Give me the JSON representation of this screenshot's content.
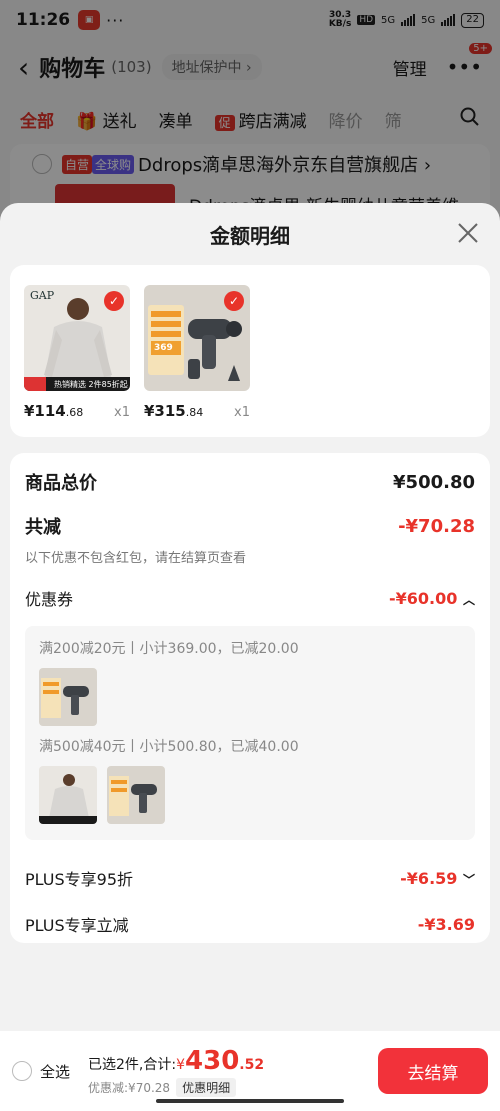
{
  "status": {
    "time": "11:26",
    "speed_top": "30.3",
    "speed_unit": "KB/s",
    "hd": "HD",
    "net1": "5G",
    "net2": "5G",
    "battery": "22"
  },
  "nav": {
    "title": "购物车",
    "count": "(103)",
    "address": "地址保护中 ›",
    "manage": "管理",
    "badge": "5+"
  },
  "filters": [
    "全部",
    "送礼",
    "凑单",
    "跨店满减",
    "降价",
    "筛"
  ],
  "promo_tag": "促",
  "store": {
    "tag_self": "自营",
    "tag_global": "全球购",
    "name": "Ddrops滴卓思海外京东自营旗舰店 ›"
  },
  "bg_product": {
    "title": "Ddrops滴卓思 新生婴幼儿童营养维"
  },
  "sheet": {
    "title": "金额明细",
    "items": [
      {
        "price_int": "¥114",
        "price_dec": ".68",
        "qty": "x1",
        "badge": "热销精选 2件85折起",
        "brand": "GAP"
      },
      {
        "price_int": "¥315",
        "price_dec": ".84",
        "qty": "x1",
        "badge": "369",
        "brand": ""
      }
    ],
    "total_label": "商品总价",
    "total_value": "¥500.80",
    "reduce_label": "共减",
    "reduce_value": "-¥70.28",
    "note": "以下优惠不包含红包，请在结算页查看",
    "coupon_label": "优惠券",
    "coupon_value": "-¥60.00",
    "coupon_lines": [
      "满200减20元丨小计369.00，已减20.00",
      "满500减40元丨小计500.80，已减40.00"
    ],
    "plus95_label": "PLUS专享95折",
    "plus95_value": "-¥6.59",
    "plusreduce_label": "PLUS专享立减",
    "plusreduce_value": "-¥3.69"
  },
  "bottom": {
    "select_all": "全选",
    "selected_text": "已选2件,合计:",
    "yen": "¥",
    "total_int": "430",
    "total_dec": ".52",
    "discount_text": "优惠减:¥70.28",
    "detail_btn": "优惠明细",
    "checkout": "去结算"
  },
  "colors": {
    "accent": "#e8332a",
    "checkout": "#f2323a"
  }
}
